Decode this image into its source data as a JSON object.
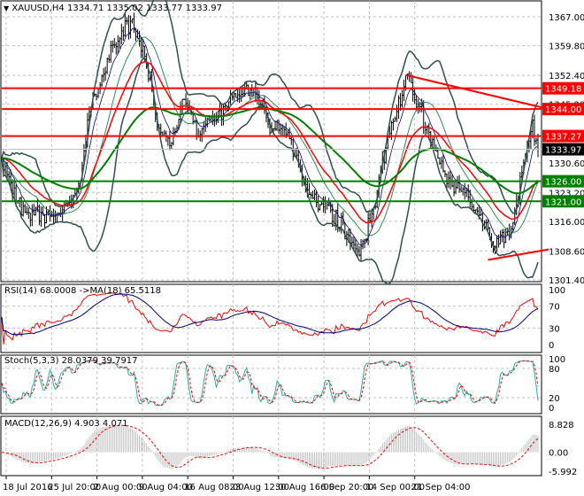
{
  "header": {
    "symbol": "XAUUSD,H4",
    "ohlc": "1334.71 1335.02 1333.77 1333.97"
  },
  "colors": {
    "up_line": "#ff0000",
    "support": "#008000",
    "bars": "#000000",
    "bands": "#2f4f4f",
    "rsi": "#ff0000",
    "rsi_ma": "#000080",
    "stoch_main": "#20b2aa",
    "stoch_signal": "#ff0000",
    "macd_hist": "#c0c0c0"
  },
  "chart_data": [
    {
      "type": "line",
      "title": "XAUUSD,H4",
      "ylim": [
        1301.4,
        1367.0
      ],
      "y_ticks": [
        "1367.00",
        "1359.80",
        "1352.40",
        "1345.20",
        "1330.60",
        "1323.20",
        "1316.00",
        "1308.60",
        "1301.40"
      ],
      "x_ticks": [
        "18 Jul 2016",
        "25 Jul 20:00",
        "2 Aug 00:00",
        "9 Aug 04:00",
        "16 Aug 08:00",
        "23 Aug 12:00",
        "30 Aug 16:00",
        "6 Sep 20:00",
        "14 Sep 00:00",
        "21 Sep 04:00"
      ],
      "bars": 300,
      "close_path": [
        [
          0,
          1331
        ],
        [
          12,
          1318
        ],
        [
          30,
          1318
        ],
        [
          42,
          1322
        ],
        [
          50,
          1345
        ],
        [
          55,
          1350
        ],
        [
          65,
          1362
        ],
        [
          72,
          1365
        ],
        [
          80,
          1358
        ],
        [
          87,
          1340
        ],
        [
          95,
          1335
        ],
        [
          102,
          1346
        ],
        [
          110,
          1338
        ],
        [
          120,
          1343
        ],
        [
          130,
          1347
        ],
        [
          142,
          1348
        ],
        [
          150,
          1340
        ],
        [
          160,
          1338
        ],
        [
          170,
          1325
        ],
        [
          180,
          1320
        ],
        [
          190,
          1315
        ],
        [
          200,
          1307
        ],
        [
          207,
          1318
        ],
        [
          215,
          1335
        ],
        [
          222,
          1345
        ],
        [
          227,
          1352
        ],
        [
          235,
          1343
        ],
        [
          242,
          1334
        ],
        [
          250,
          1326
        ],
        [
          260,
          1323
        ],
        [
          267,
          1318
        ],
        [
          275,
          1310
        ],
        [
          285,
          1314
        ],
        [
          292,
          1330
        ],
        [
          297,
          1340
        ],
        [
          300,
          1334
        ]
      ],
      "hlines": [
        {
          "price": 1349.18,
          "label": "1349.18",
          "color": "red"
        },
        {
          "price": 1344.0,
          "label": "1344.00",
          "color": "red"
        },
        {
          "price": 1337.27,
          "label": "1337.27",
          "color": "red"
        },
        {
          "price": 1326.0,
          "label": "1326.00",
          "color": "green"
        },
        {
          "price": 1321.0,
          "label": "1321.00",
          "color": "green"
        }
      ],
      "current_price": {
        "price": 1333.97,
        "label": "1333.97"
      },
      "trendlines": [
        {
          "from": [
            226,
            1352.5
          ],
          "to": [
            306,
            1344.0
          ]
        },
        {
          "from": [
            272,
            1306.4
          ],
          "to": [
            306,
            1309.0
          ]
        }
      ]
    },
    {
      "type": "line",
      "title": "RSI(14) 68.0008  ->MA(18) 65.5118",
      "ylim": [
        0,
        100
      ],
      "y_ticks": [
        "100",
        "70",
        "30",
        "0"
      ],
      "levels": [
        70,
        30
      ]
    },
    {
      "type": "line",
      "title": "Stoch(5,3,3) 28.0379 39.7917",
      "ylim": [
        0,
        100
      ],
      "y_ticks": [
        "100",
        "80",
        "20",
        "0"
      ],
      "levels": [
        80,
        20
      ]
    },
    {
      "type": "bar",
      "title": "MACD(12,26,9) 4.903 4.071",
      "ylim": [
        -5.992,
        8.828
      ],
      "y_ticks": [
        "8.828",
        "0.00",
        "-5.992"
      ]
    }
  ]
}
